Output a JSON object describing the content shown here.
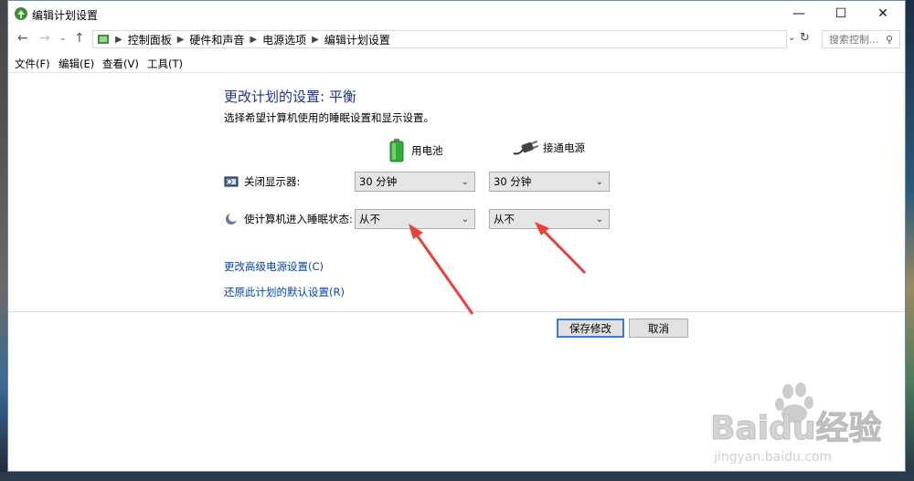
{
  "window": {
    "title": "编辑计划设置"
  },
  "address": {
    "crumbs": [
      "控制面板",
      "硬件和声音",
      "电源选项",
      "编辑计划设置"
    ],
    "search_placeholder": "搜索控制..."
  },
  "menu": [
    "文件(F)",
    "编辑(E)",
    "查看(V)",
    "工具(T)"
  ],
  "main": {
    "heading": "更改计划的设置: 平衡",
    "subtitle": "选择希望计算机使用的睡眠设置和显示设置。",
    "battery_label": "用电池",
    "plugged_label": "接通电源",
    "rows": [
      {
        "label": "关闭显示器:",
        "battery_value": "30 分钟",
        "plugged_value": "30 分钟"
      },
      {
        "label": "使计算机进入睡眠状态:",
        "battery_value": "从不",
        "plugged_value": "从不"
      }
    ],
    "links": [
      "更改高级电源设置(C)",
      "还原此计划的默认设置(R)"
    ]
  },
  "buttons": {
    "save": "保存修改",
    "cancel": "取消"
  },
  "watermark": {
    "brand": "Baidu经验",
    "url": "jingyan.baidu.com"
  },
  "colors": {
    "heading": "#1e3287",
    "link": "#0645ad",
    "annotation_arrow": "#e8413a",
    "primary_button_border": "#3a7bd5"
  }
}
